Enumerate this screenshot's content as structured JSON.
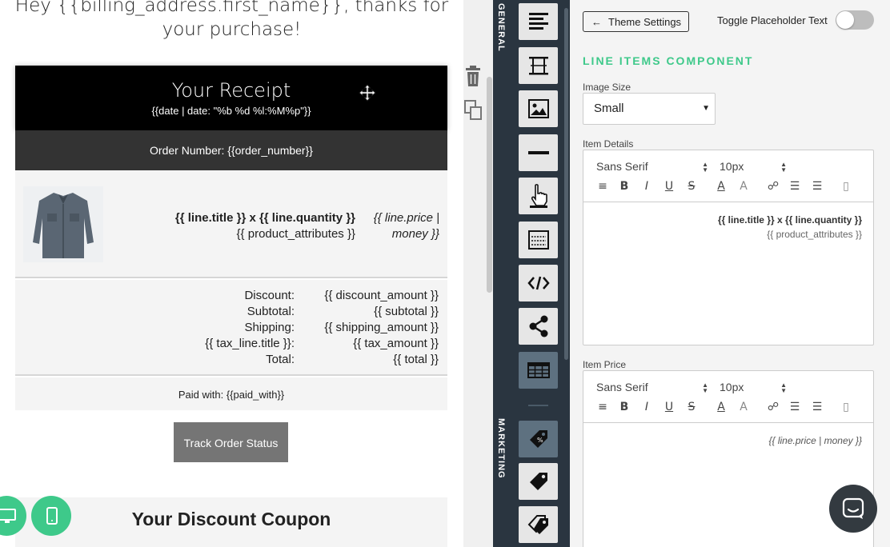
{
  "preview": {
    "greeting": "Hey {{billing_address.first_name}}, thanks for your purchase!",
    "receipt_title": "Your Receipt",
    "receipt_date": "{{date | date: \"%b %d %l:%M%p\"}}",
    "order_number": "Order Number: {{order_number}}",
    "line_title_part1": "{{ line.title }}",
    "line_title_sep": " x ",
    "line_title_part2": "{{ line.quantity }}",
    "line_attrs": "{{ product_attributes }}",
    "line_price_1": "{{ line.price |",
    "line_price_2": "money }}",
    "totals": [
      {
        "label": "Discount:",
        "value": "{{ discount_amount }}"
      },
      {
        "label": "Subtotal:",
        "value": "{{ subtotal }}"
      },
      {
        "label": "Shipping:",
        "value": "{{ shipping_amount }}"
      },
      {
        "label": "{{ tax_line.title }}:",
        "value": "{{ tax_amount }}"
      },
      {
        "label": "Total:",
        "value": "{{ total }}"
      }
    ],
    "paid_with": "Paid with: {{paid_with}}",
    "track_button": "Track Order Status",
    "coupon_title": "Your Discount Coupon"
  },
  "palette": {
    "section_general": "GENERAL",
    "section_marketing": "MARKETING",
    "tools": [
      "text-align-icon",
      "spacer-icon",
      "image-icon",
      "divider-icon",
      "button-click-icon",
      "form-field-icon",
      "code-icon",
      "share-icon",
      "table-icon",
      "coupon-tag-icon",
      "price-tag-icon",
      "tags-icon"
    ],
    "active_tool": "table-icon"
  },
  "settings": {
    "theme_button": "Theme Settings",
    "toggle_label": "Toggle Placeholder Text",
    "toggle_on": false,
    "section_title": "LINE ITEMS COMPONENT",
    "image_size_label": "Image Size",
    "image_size_value": "Small",
    "item_details_label": "Item Details",
    "item_price_label": "Item Price",
    "font_value": "Sans Serif",
    "size_value": "10px",
    "details_line1": "{{ line.title }} x {{ line.quantity }}",
    "details_line2": "{{ product_attributes }}",
    "price_line": "{{ line.price | money }}"
  },
  "colors": {
    "accent_green": "#3ec98a",
    "palette_bg": "#2a3540",
    "receipt_head_bg": "#000000",
    "order_bar_bg": "#333333",
    "track_button_bg": "#757575"
  }
}
